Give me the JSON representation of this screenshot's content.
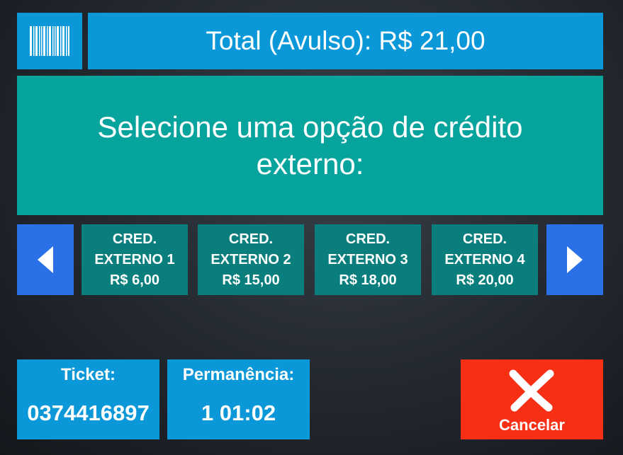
{
  "header": {
    "barcode_icon": "barcode-icon",
    "total_label": "Total (Avulso): R$ 21,00"
  },
  "prompt": {
    "text": "Selecione uma opção de crédito externo:"
  },
  "carousel": {
    "prev_icon": "arrow-left-icon",
    "next_icon": "arrow-right-icon",
    "options": [
      {
        "line1": "CRED.",
        "line2": "EXTERNO 1",
        "price": "R$ 6,00"
      },
      {
        "line1": "CRED.",
        "line2": "EXTERNO 2",
        "price": "R$ 15,00"
      },
      {
        "line1": "CRED.",
        "line2": "EXTERNO 3",
        "price": "R$ 18,00"
      },
      {
        "line1": "CRED.",
        "line2": "EXTERNO 4",
        "price": "R$ 20,00"
      }
    ]
  },
  "ticket": {
    "label": "Ticket:",
    "value": "0374416897"
  },
  "stay": {
    "label": "Permanência:",
    "value": "1 01:02"
  },
  "cancel": {
    "label": "Cancelar",
    "icon": "close-icon"
  },
  "colors": {
    "blue": "#0a98d8",
    "teal": "#07a49d",
    "dark_teal": "#0a7e7c",
    "arrow_blue": "#2a70e6",
    "cancel_red": "#f72f15"
  }
}
